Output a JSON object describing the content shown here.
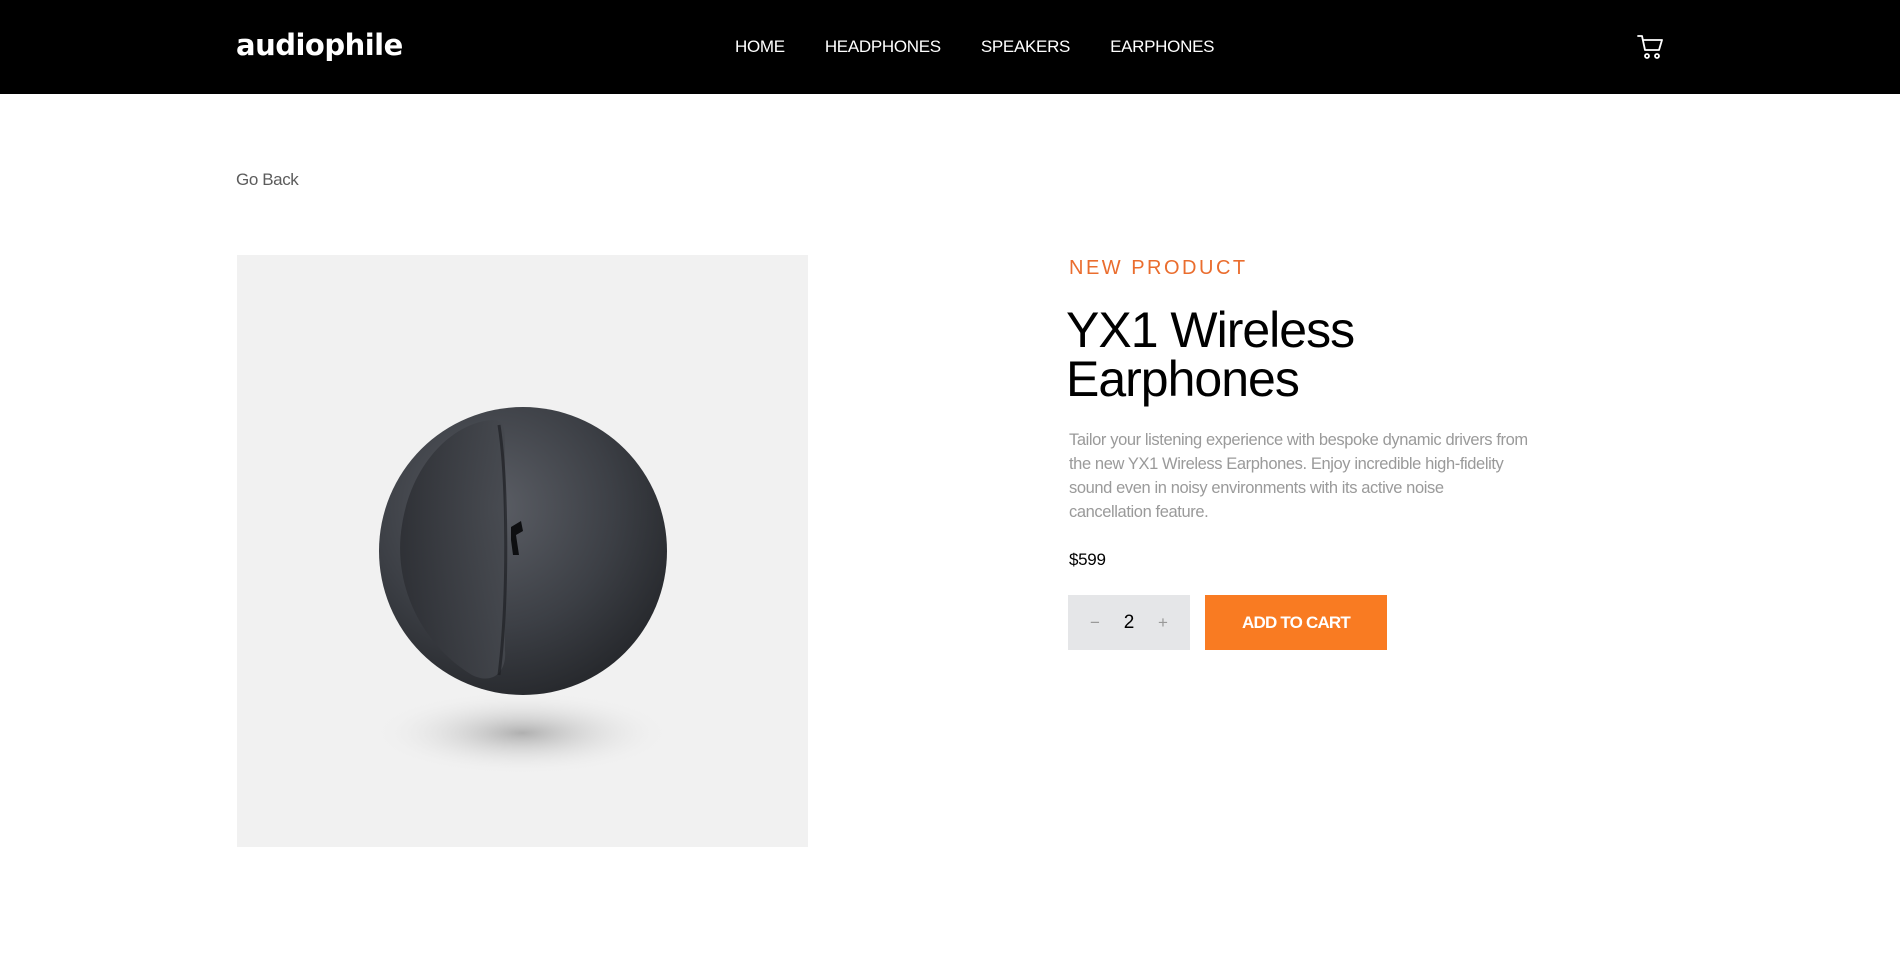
{
  "header": {
    "logo": "audiophile",
    "nav": [
      "HOME",
      "HEADPHONES",
      "SPEAKERS",
      "EARPHONES"
    ],
    "cart_icon": "cart-icon"
  },
  "page": {
    "go_back": "Go Back"
  },
  "product": {
    "overline": "NEW PRODUCT",
    "title": "YX1 Wireless Earphones",
    "description": "Tailor your listening experience with bespoke dynamic drivers from the new YX1 Wireless Earphones. Enjoy incredible high-fidelity sound even in noisy environments with its active noise cancellation feature.",
    "price": "$599",
    "quantity": "2",
    "decrement": "−",
    "increment": "+",
    "add_to_cart": "ADD TO CART",
    "image_icon": "earphone-image"
  },
  "colors": {
    "accent": "#f97b22",
    "header_bg": "#000000",
    "image_bg": "#f1f1f1"
  }
}
